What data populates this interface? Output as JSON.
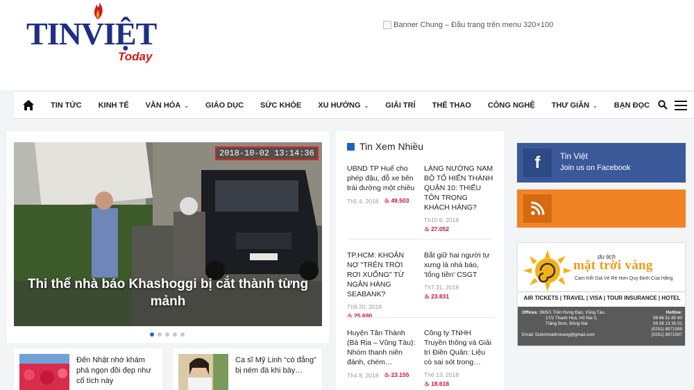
{
  "header": {
    "logo_main": "TINVIỆT",
    "logo_sub": "Today",
    "banner_alt": "Banner Chung – Đầu trang trên menu 320×100"
  },
  "nav": {
    "items": [
      {
        "label": "TIN TỨC",
        "dropdown": false
      },
      {
        "label": "KINH TẾ",
        "dropdown": false
      },
      {
        "label": "VĂN HÓA",
        "dropdown": true
      },
      {
        "label": "GIÁO DỤC",
        "dropdown": false
      },
      {
        "label": "SỨC KHỎE",
        "dropdown": false
      },
      {
        "label": "XU HƯỚNG",
        "dropdown": true
      },
      {
        "label": "GIẢI TRÍ",
        "dropdown": false
      },
      {
        "label": "THỂ THAO",
        "dropdown": false
      },
      {
        "label": "CÔNG NGHỆ",
        "dropdown": false
      },
      {
        "label": "THƯ GIÃN",
        "dropdown": true
      },
      {
        "label": "BẠN ĐỌC",
        "dropdown": false
      }
    ],
    "chevron": "⌄"
  },
  "slider": {
    "caption": "Thi thể nhà báo Khashoggi bị cắt thành từng mảnh",
    "timestamp": "2018-10-02 13:14:36",
    "slide_count": 5,
    "active_index": 0
  },
  "mini_cards": [
    {
      "title": "Đến Nhật nhớ khám phá ngọn đồi đẹp như cổ tích này"
    },
    {
      "title": "Ca sĩ Mỹ Linh “có đắng” bị ném đá khi bày…"
    }
  ],
  "popular": {
    "heading": "Tin Xem Nhiều",
    "items": [
      {
        "title": "UBND TP Huế cho phép đậu, đỗ xe bên trái đường một chiều",
        "date": "Th5 4, 2018",
        "views": "49.503"
      },
      {
        "title": "LÀNG NƯỚNG NAM BỘ TỐ HIẾN THÀNH QUẬN 10: THIẾU TÔN TRỌNG KHÁCH HÀNG?",
        "date": "Th10 6, 2018",
        "views": "27.052"
      },
      {
        "title": "TP.HCM: KHOẢN NỢ \"TRÊN TRỜI RƠI XUỐNG\" TỪ NGÂN HÀNG SEABANK?",
        "date": "Th9 20, 2018",
        "views": "25.690"
      },
      {
        "title": "Bắt giữ hai người tự xưng là nhà báo, 'tống tiền' CSGT",
        "date": "Th7 31, 2018",
        "views": "23.831"
      },
      {
        "title": "Huyện Tân Thành (Bà Rịa – Vũng Tàu): Nhóm thanh niên đánh, chém…",
        "date": "Th4 8, 2018",
        "views": "23.155"
      },
      {
        "title": "Công ty TNHH Truyền thông và Giải trí Điền Quân: Liệu có sai sót trong…",
        "date": "Th6 13, 2018",
        "views": "18.618"
      }
    ]
  },
  "social": {
    "fb_name": "Tin Việt",
    "fb_join": "Join us on Facebook",
    "fb_letter": "f"
  },
  "ad": {
    "prefix": "du lịch",
    "brand": "mặt trời vàng",
    "slogan": "Cam Kết Giá Vé Rẻ Hơn Quy Định Của Hãng",
    "services": "AIR TICKETS | TRAVEL | VISA | TOUR INSURANCE | HOTEL BOOKING",
    "offices_label": "Offices:",
    "addr1": "36/5/1 Trần Hưng Đạo, Vũng Tàu.",
    "addr2": "17/2 Thanh Hoá, Hố Nai 3,",
    "addr3": "Trảng Bom, Đồng Nai",
    "email": "Email: Dulichmattroivang@gmail.com",
    "hotline_label": "Hotline:",
    "phone1": "08 68 51 80 80",
    "phone2": "09 08 13 35 01",
    "phone3": "(0251) 8971599",
    "phone4": "(0251) 8971597"
  },
  "colors": {
    "brand_blue": "#1f2f86",
    "brand_red": "#d11a1a",
    "facebook": "#3b5998",
    "rss": "#f08324",
    "accent": "#1e62c8"
  }
}
